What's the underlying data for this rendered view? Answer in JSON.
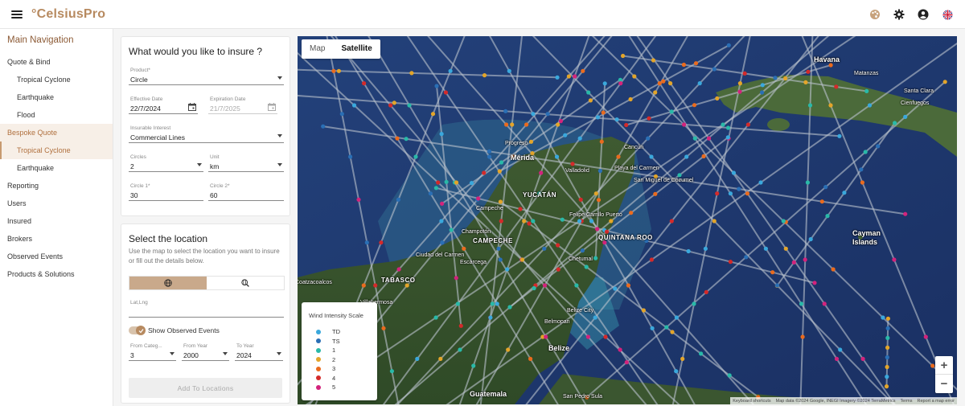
{
  "app": {
    "brand": "°CelsiusPro"
  },
  "header_icons": [
    "palette-icon",
    "gear-icon",
    "account-icon",
    "flag-uk-icon"
  ],
  "sidebar": {
    "title": "Main Navigation",
    "items": [
      {
        "label": "Quote & Bind",
        "sub": false
      },
      {
        "label": "Tropical Cyclone",
        "sub": true
      },
      {
        "label": "Earthquake",
        "sub": true
      },
      {
        "label": "Flood",
        "sub": true
      },
      {
        "label": "Bespoke Quote",
        "sub": false,
        "state": "active-parent"
      },
      {
        "label": "Tropical Cyclone",
        "sub": true,
        "state": "active"
      },
      {
        "label": "Earthquake",
        "sub": true
      },
      {
        "label": "Reporting",
        "sub": false
      },
      {
        "label": "Users",
        "sub": false
      },
      {
        "label": "Insured",
        "sub": false
      },
      {
        "label": "Brokers",
        "sub": false
      },
      {
        "label": "Observed Events",
        "sub": false
      },
      {
        "label": "Products & Solutions",
        "sub": false
      }
    ]
  },
  "insure_form": {
    "title": "What would you like to insure ?",
    "product": {
      "label": "Product*",
      "value": "Circle"
    },
    "effective_date": {
      "label": "Effective Date",
      "value": "22/7/2024"
    },
    "expiration_date": {
      "label": "Expiration Date",
      "value": "21/7/2025"
    },
    "insurable_interest": {
      "label": "Insurable Interest",
      "value": "Commercial Lines"
    },
    "circles": {
      "label": "Circles",
      "value": "2"
    },
    "unit": {
      "label": "Unit",
      "value": "km"
    },
    "circle1": {
      "label": "Circle 1*",
      "value": "30"
    },
    "circle2": {
      "label": "Circle 2*",
      "value": "60"
    }
  },
  "location_form": {
    "title": "Select the location",
    "description": "Use the map to select the location you want to insure or fill out the details below.",
    "latlng": {
      "label": "Lat,Lng",
      "value": ""
    },
    "show_events": {
      "label": "Show Observed Events",
      "on": true
    },
    "from_category": {
      "label": "From Categ...",
      "value": "3"
    },
    "from_year": {
      "label": "From Year",
      "value": "2000"
    },
    "to_year": {
      "label": "To Year",
      "value": "2024"
    },
    "add_button": "Add To Locations"
  },
  "map": {
    "type_buttons": [
      "Map",
      "Satellite"
    ],
    "selected_type": "Satellite",
    "legend": {
      "title": "Wind Intensity Scale",
      "entries": [
        {
          "label": "TD",
          "color": "#3aa8dc"
        },
        {
          "label": "TS",
          "color": "#2a6fb5"
        },
        {
          "label": "1",
          "color": "#29b9a8"
        },
        {
          "label": "2",
          "color": "#e3a52a"
        },
        {
          "label": "3",
          "color": "#ea6b1e"
        },
        {
          "label": "4",
          "color": "#d42a2a"
        },
        {
          "label": "5",
          "color": "#d3237c"
        }
      ]
    },
    "zoom_in": "+",
    "zoom_out": "−",
    "attribution": [
      "Keyboard shortcuts",
      "Map data ©2024 Google, INEGI Imagery ©2024 TerraMetrics",
      "Terms",
      "Report a map error"
    ],
    "places": [
      {
        "name": "Havana",
        "cls": "big"
      },
      {
        "name": "Matanzas",
        "cls": ""
      },
      {
        "name": "Santa Clara",
        "cls": ""
      },
      {
        "name": "Cienfuegos",
        "cls": ""
      },
      {
        "name": "Cancún",
        "cls": ""
      },
      {
        "name": "Progreso",
        "cls": ""
      },
      {
        "name": "Mérida",
        "cls": "big"
      },
      {
        "name": "Valladolid",
        "cls": ""
      },
      {
        "name": "Playa del Carmen",
        "cls": ""
      },
      {
        "name": "San Miguel de Cozumel",
        "cls": ""
      },
      {
        "name": "YUCATÁN",
        "cls": "cap"
      },
      {
        "name": "Campeche",
        "cls": ""
      },
      {
        "name": "Champotón",
        "cls": ""
      },
      {
        "name": "CAMPECHE",
        "cls": "cap"
      },
      {
        "name": "QUINTANA ROO",
        "cls": "cap"
      },
      {
        "name": "Felipe Carrillo Puerto",
        "cls": ""
      },
      {
        "name": "Ciudad del Carmen",
        "cls": ""
      },
      {
        "name": "Escárcega",
        "cls": ""
      },
      {
        "name": "Chetumal",
        "cls": ""
      },
      {
        "name": "TABASCO",
        "cls": "cap"
      },
      {
        "name": "Villahermosa",
        "cls": ""
      },
      {
        "name": "Coatzacoalcos",
        "cls": ""
      },
      {
        "name": "Belize City",
        "cls": ""
      },
      {
        "name": "Belize",
        "cls": "big"
      },
      {
        "name": "Belmopan",
        "cls": ""
      },
      {
        "name": "Guatemala",
        "cls": "big"
      },
      {
        "name": "San Pedro Sula",
        "cls": ""
      },
      {
        "name": "Cayman Islands",
        "cls": "big"
      }
    ]
  }
}
